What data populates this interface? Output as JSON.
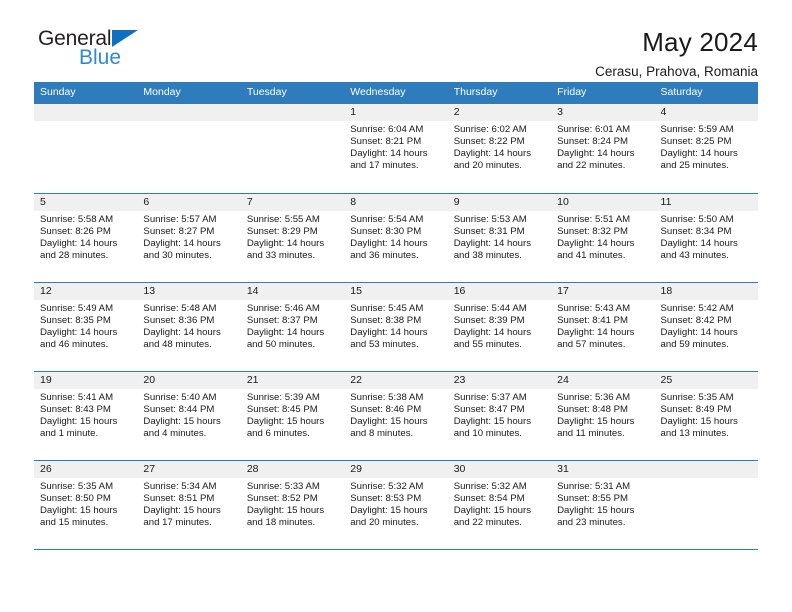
{
  "brand": {
    "name_part1": "General",
    "name_part2": "Blue",
    "flag_icon": "brand-flag-icon"
  },
  "header": {
    "title": "May 2024",
    "subtitle": "Cerasu, Prahova, Romania"
  },
  "calendar": {
    "weekdays": [
      "Sunday",
      "Monday",
      "Tuesday",
      "Wednesday",
      "Thursday",
      "Friday",
      "Saturday"
    ],
    "colors": {
      "header_blue": "#2f7cbd",
      "day_band_gray": "#f0f0f0",
      "brand_dark": "#231f20",
      "brand_blue": "#2e8ad6",
      "text": "#1a1a1a"
    },
    "weeks": [
      [
        {
          "day": "",
          "sunrise": "",
          "sunset": "",
          "daylight_line1": "",
          "daylight_line2": ""
        },
        {
          "day": "",
          "sunrise": "",
          "sunset": "",
          "daylight_line1": "",
          "daylight_line2": ""
        },
        {
          "day": "",
          "sunrise": "",
          "sunset": "",
          "daylight_line1": "",
          "daylight_line2": ""
        },
        {
          "day": "1",
          "sunrise": "Sunrise: 6:04 AM",
          "sunset": "Sunset: 8:21 PM",
          "daylight_line1": "Daylight: 14 hours",
          "daylight_line2": "and 17 minutes."
        },
        {
          "day": "2",
          "sunrise": "Sunrise: 6:02 AM",
          "sunset": "Sunset: 8:22 PM",
          "daylight_line1": "Daylight: 14 hours",
          "daylight_line2": "and 20 minutes."
        },
        {
          "day": "3",
          "sunrise": "Sunrise: 6:01 AM",
          "sunset": "Sunset: 8:24 PM",
          "daylight_line1": "Daylight: 14 hours",
          "daylight_line2": "and 22 minutes."
        },
        {
          "day": "4",
          "sunrise": "Sunrise: 5:59 AM",
          "sunset": "Sunset: 8:25 PM",
          "daylight_line1": "Daylight: 14 hours",
          "daylight_line2": "and 25 minutes."
        }
      ],
      [
        {
          "day": "5",
          "sunrise": "Sunrise: 5:58 AM",
          "sunset": "Sunset: 8:26 PM",
          "daylight_line1": "Daylight: 14 hours",
          "daylight_line2": "and 28 minutes."
        },
        {
          "day": "6",
          "sunrise": "Sunrise: 5:57 AM",
          "sunset": "Sunset: 8:27 PM",
          "daylight_line1": "Daylight: 14 hours",
          "daylight_line2": "and 30 minutes."
        },
        {
          "day": "7",
          "sunrise": "Sunrise: 5:55 AM",
          "sunset": "Sunset: 8:29 PM",
          "daylight_line1": "Daylight: 14 hours",
          "daylight_line2": "and 33 minutes."
        },
        {
          "day": "8",
          "sunrise": "Sunrise: 5:54 AM",
          "sunset": "Sunset: 8:30 PM",
          "daylight_line1": "Daylight: 14 hours",
          "daylight_line2": "and 36 minutes."
        },
        {
          "day": "9",
          "sunrise": "Sunrise: 5:53 AM",
          "sunset": "Sunset: 8:31 PM",
          "daylight_line1": "Daylight: 14 hours",
          "daylight_line2": "and 38 minutes."
        },
        {
          "day": "10",
          "sunrise": "Sunrise: 5:51 AM",
          "sunset": "Sunset: 8:32 PM",
          "daylight_line1": "Daylight: 14 hours",
          "daylight_line2": "and 41 minutes."
        },
        {
          "day": "11",
          "sunrise": "Sunrise: 5:50 AM",
          "sunset": "Sunset: 8:34 PM",
          "daylight_line1": "Daylight: 14 hours",
          "daylight_line2": "and 43 minutes."
        }
      ],
      [
        {
          "day": "12",
          "sunrise": "Sunrise: 5:49 AM",
          "sunset": "Sunset: 8:35 PM",
          "daylight_line1": "Daylight: 14 hours",
          "daylight_line2": "and 46 minutes."
        },
        {
          "day": "13",
          "sunrise": "Sunrise: 5:48 AM",
          "sunset": "Sunset: 8:36 PM",
          "daylight_line1": "Daylight: 14 hours",
          "daylight_line2": "and 48 minutes."
        },
        {
          "day": "14",
          "sunrise": "Sunrise: 5:46 AM",
          "sunset": "Sunset: 8:37 PM",
          "daylight_line1": "Daylight: 14 hours",
          "daylight_line2": "and 50 minutes."
        },
        {
          "day": "15",
          "sunrise": "Sunrise: 5:45 AM",
          "sunset": "Sunset: 8:38 PM",
          "daylight_line1": "Daylight: 14 hours",
          "daylight_line2": "and 53 minutes."
        },
        {
          "day": "16",
          "sunrise": "Sunrise: 5:44 AM",
          "sunset": "Sunset: 8:39 PM",
          "daylight_line1": "Daylight: 14 hours",
          "daylight_line2": "and 55 minutes."
        },
        {
          "day": "17",
          "sunrise": "Sunrise: 5:43 AM",
          "sunset": "Sunset: 8:41 PM",
          "daylight_line1": "Daylight: 14 hours",
          "daylight_line2": "and 57 minutes."
        },
        {
          "day": "18",
          "sunrise": "Sunrise: 5:42 AM",
          "sunset": "Sunset: 8:42 PM",
          "daylight_line1": "Daylight: 14 hours",
          "daylight_line2": "and 59 minutes."
        }
      ],
      [
        {
          "day": "19",
          "sunrise": "Sunrise: 5:41 AM",
          "sunset": "Sunset: 8:43 PM",
          "daylight_line1": "Daylight: 15 hours",
          "daylight_line2": "and 1 minute."
        },
        {
          "day": "20",
          "sunrise": "Sunrise: 5:40 AM",
          "sunset": "Sunset: 8:44 PM",
          "daylight_line1": "Daylight: 15 hours",
          "daylight_line2": "and 4 minutes."
        },
        {
          "day": "21",
          "sunrise": "Sunrise: 5:39 AM",
          "sunset": "Sunset: 8:45 PM",
          "daylight_line1": "Daylight: 15 hours",
          "daylight_line2": "and 6 minutes."
        },
        {
          "day": "22",
          "sunrise": "Sunrise: 5:38 AM",
          "sunset": "Sunset: 8:46 PM",
          "daylight_line1": "Daylight: 15 hours",
          "daylight_line2": "and 8 minutes."
        },
        {
          "day": "23",
          "sunrise": "Sunrise: 5:37 AM",
          "sunset": "Sunset: 8:47 PM",
          "daylight_line1": "Daylight: 15 hours",
          "daylight_line2": "and 10 minutes."
        },
        {
          "day": "24",
          "sunrise": "Sunrise: 5:36 AM",
          "sunset": "Sunset: 8:48 PM",
          "daylight_line1": "Daylight: 15 hours",
          "daylight_line2": "and 11 minutes."
        },
        {
          "day": "25",
          "sunrise": "Sunrise: 5:35 AM",
          "sunset": "Sunset: 8:49 PM",
          "daylight_line1": "Daylight: 15 hours",
          "daylight_line2": "and 13 minutes."
        }
      ],
      [
        {
          "day": "26",
          "sunrise": "Sunrise: 5:35 AM",
          "sunset": "Sunset: 8:50 PM",
          "daylight_line1": "Daylight: 15 hours",
          "daylight_line2": "and 15 minutes."
        },
        {
          "day": "27",
          "sunrise": "Sunrise: 5:34 AM",
          "sunset": "Sunset: 8:51 PM",
          "daylight_line1": "Daylight: 15 hours",
          "daylight_line2": "and 17 minutes."
        },
        {
          "day": "28",
          "sunrise": "Sunrise: 5:33 AM",
          "sunset": "Sunset: 8:52 PM",
          "daylight_line1": "Daylight: 15 hours",
          "daylight_line2": "and 18 minutes."
        },
        {
          "day": "29",
          "sunrise": "Sunrise: 5:32 AM",
          "sunset": "Sunset: 8:53 PM",
          "daylight_line1": "Daylight: 15 hours",
          "daylight_line2": "and 20 minutes."
        },
        {
          "day": "30",
          "sunrise": "Sunrise: 5:32 AM",
          "sunset": "Sunset: 8:54 PM",
          "daylight_line1": "Daylight: 15 hours",
          "daylight_line2": "and 22 minutes."
        },
        {
          "day": "31",
          "sunrise": "Sunrise: 5:31 AM",
          "sunset": "Sunset: 8:55 PM",
          "daylight_line1": "Daylight: 15 hours",
          "daylight_line2": "and 23 minutes."
        },
        {
          "day": "",
          "sunrise": "",
          "sunset": "",
          "daylight_line1": "",
          "daylight_line2": ""
        }
      ]
    ]
  }
}
